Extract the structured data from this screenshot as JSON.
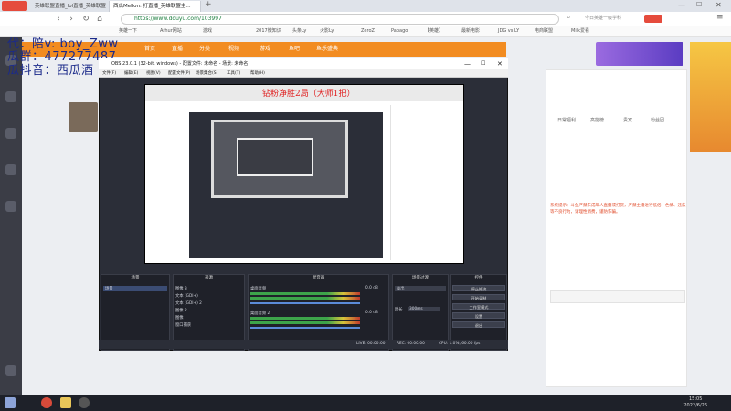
{
  "browser": {
    "tabs": [
      {
        "label": "英雄联盟直播_lol直播_英雄联盟"
      },
      {
        "label": "西瓜Mellon: 打直播_英雄联盟主..."
      }
    ],
    "url": "https://www.douyu.com/103997",
    "search_placeholder": "今日英雄一级学科",
    "bookmarks": [
      "英雄一下",
      "Arhur网站",
      "游戏",
      "2017微知识",
      "头条Ly",
      "火影Ly",
      "ZeroZ",
      "Papago",
      "【英雄】",
      "最新电影",
      "JDG vs LY",
      "电商联盟",
      "Milk爱看"
    ]
  },
  "overlay": {
    "title": "钻粉净胜2局（大师1把）",
    "line1": "代：陪v: boy_Zww",
    "line2": "瓜群：477277487",
    "line3": "瓜抖音：西瓜酒"
  },
  "site": {
    "nav": [
      "首页",
      "直播",
      "分类",
      "视频",
      "游戏",
      "鱼吧",
      "鱼乐盛典"
    ],
    "right_tabs": [
      "日常福利",
      "高能榜",
      "贵宾",
      "粉丝团"
    ],
    "notice": "系统提示：斗鱼严禁未成年人直播或打赏，严禁主播进行低俗、色情、违法等不良行为，请理性消费，谨防诈骗。"
  },
  "obs": {
    "title": "OBS 23.0.1 (32-bit, windows) - 配置文件: 未命名 - 场景: 未命名",
    "menu": [
      "文件(F)",
      "编辑(E)",
      "视图(V)",
      "配置文件(P)",
      "场景集合(S)",
      "工具(T)",
      "帮助(H)"
    ],
    "docks": {
      "scenes": "场景",
      "sources": "来源",
      "mixer": "混音器",
      "transitions": "场景过渡",
      "controls": "控件"
    },
    "scene_items": [
      "场景"
    ],
    "source_items": [
      "图像 3",
      "文本 (GDI+)",
      "文本 (GDI+) 2",
      "图像 2",
      "图像",
      "窗口捕获"
    ],
    "mixer_tracks": [
      {
        "name": "桌面音频",
        "db": "0.0 dB"
      },
      {
        "name": "桌面音频 2",
        "db": "0.0 dB"
      }
    ],
    "transition": "淡出",
    "duration_label": "时长",
    "duration": "300ms",
    "buttons": [
      "停止推流",
      "开始录制",
      "工作室模式",
      "设置",
      "退出"
    ],
    "status": {
      "live": "LIVE: 00:00:00",
      "rec": "REC: 00:00:00",
      "cpu": "CPU: 1.0%, 60.00 fps"
    }
  },
  "taskbar": {
    "time": "15:05",
    "date": "2022/6/26"
  }
}
